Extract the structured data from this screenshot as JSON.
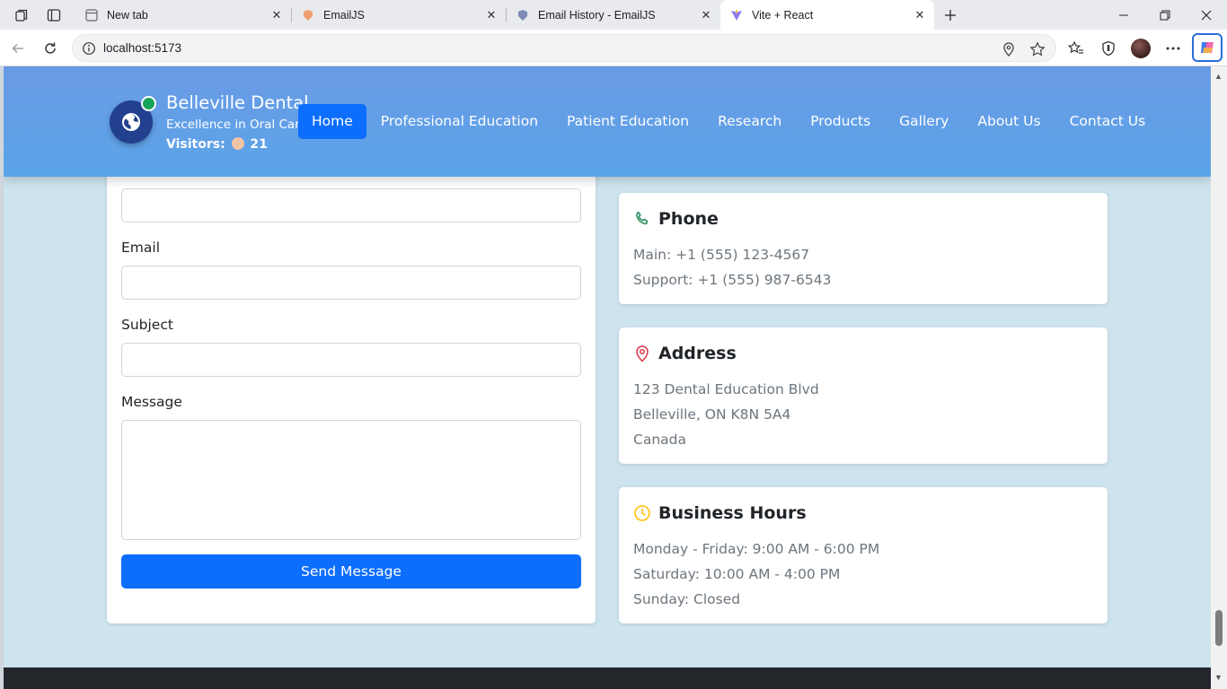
{
  "browser": {
    "tabs": [
      {
        "title": "New tab"
      },
      {
        "title": "EmailJS"
      },
      {
        "title": "Email History - EmailJS"
      },
      {
        "title": "Vite + React"
      }
    ],
    "url": "localhost:5173"
  },
  "header": {
    "brand_name": "Belleville Dental",
    "tagline": "Excellence in Oral Care",
    "visitors_label": "Visitors:",
    "visitors_count": "21",
    "nav": [
      {
        "label": "Home"
      },
      {
        "label": "Professional Education"
      },
      {
        "label": "Patient Education"
      },
      {
        "label": "Research"
      },
      {
        "label": "Products"
      },
      {
        "label": "Gallery"
      },
      {
        "label": "About Us"
      },
      {
        "label": "Contact Us"
      }
    ]
  },
  "form": {
    "email_label": "Email",
    "subject_label": "Subject",
    "message_label": "Message",
    "send_label": "Send Message"
  },
  "phone": {
    "title": "Phone",
    "lines": [
      "Main: +1 (555) 123-4567",
      "Support: +1 (555) 987-6543"
    ]
  },
  "address": {
    "title": "Address",
    "lines": [
      "123 Dental Education Blvd",
      "Belleville, ON K8N 5A4",
      "Canada"
    ]
  },
  "hours": {
    "title": "Business Hours",
    "lines": [
      "Monday - Friday: 9:00 AM - 6:00 PM",
      "Saturday: 10:00 AM - 4:00 PM",
      "Sunday: Closed"
    ]
  },
  "colors": {
    "header_gradient_top": "#6a9ae6",
    "header_gradient_bottom": "#5aa4e8",
    "page_bg": "#cde4ee",
    "primary": "#0d6efd",
    "phone_icon": "#198754",
    "address_icon": "#dc3545",
    "hours_icon": "#ffc107"
  }
}
